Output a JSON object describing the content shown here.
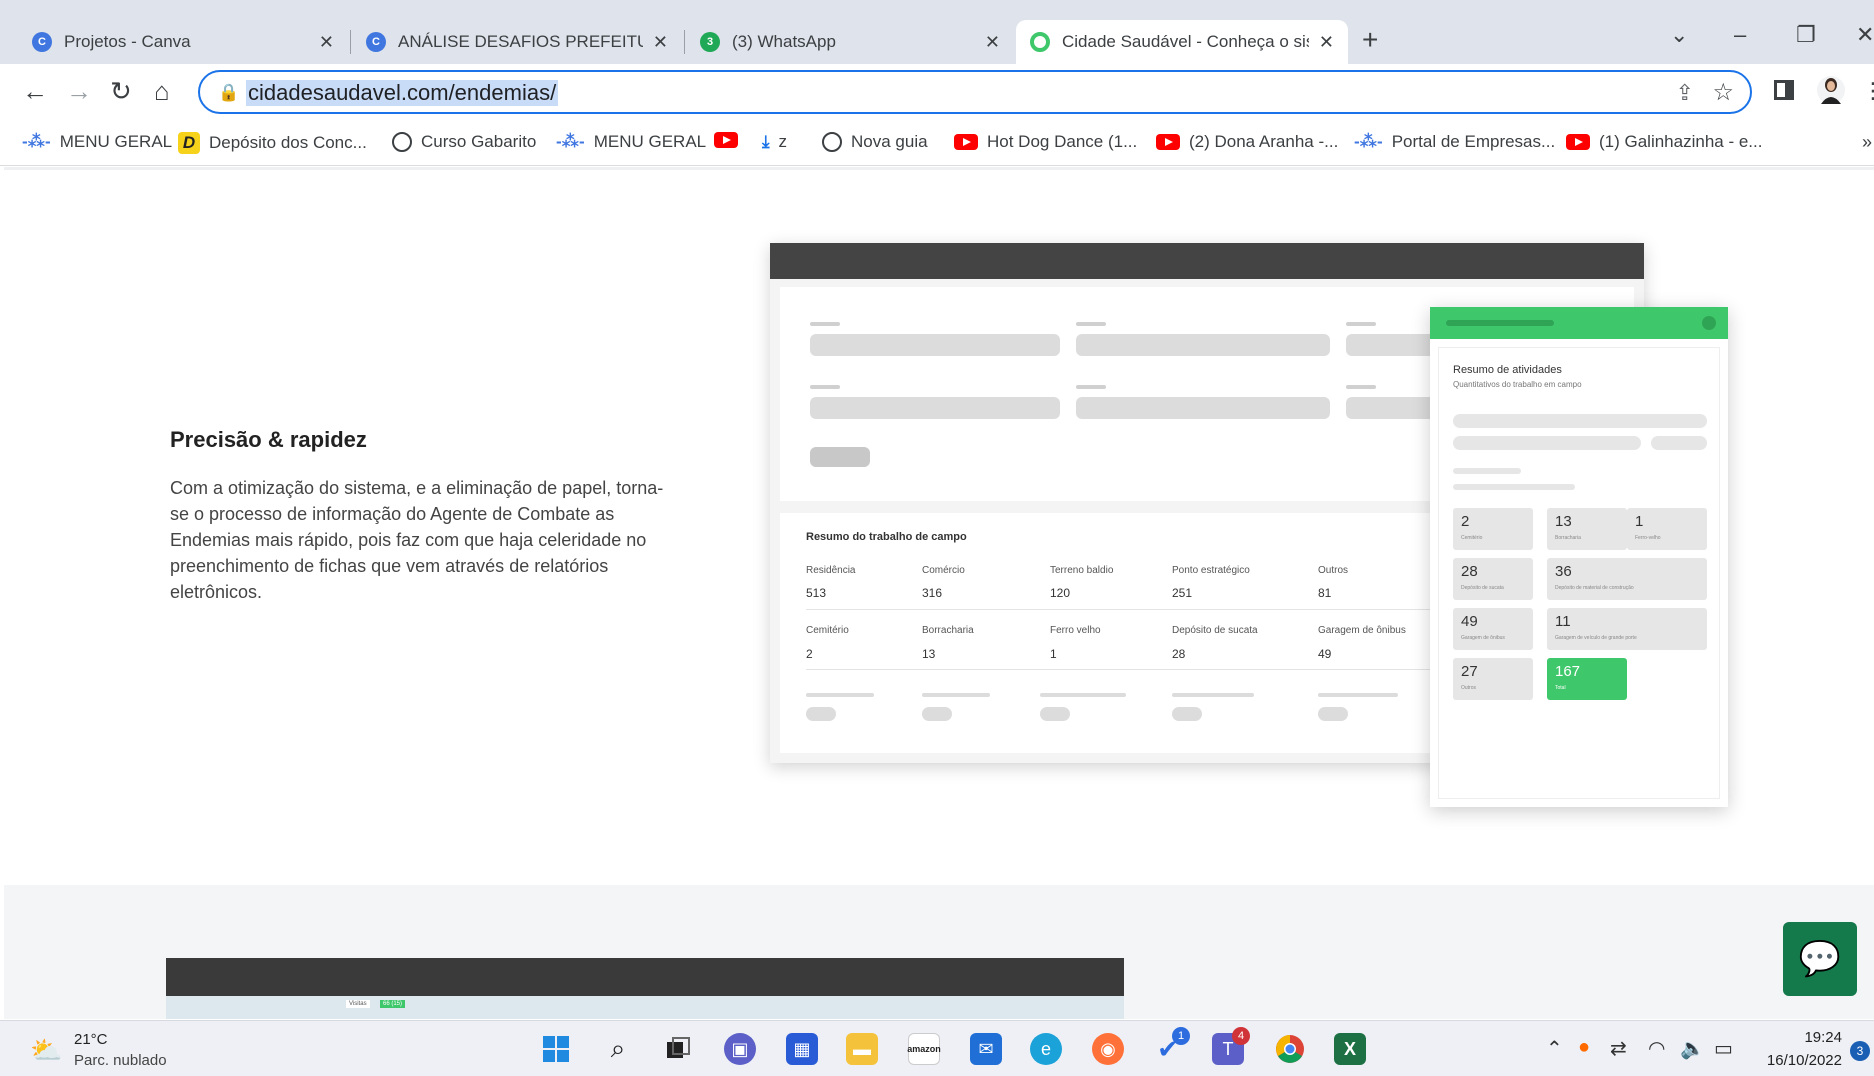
{
  "browser": {
    "tabs": [
      {
        "title": "Projetos - Canva",
        "icon": "canva-icon"
      },
      {
        "title": "ANÁLISE DESAFIOS PREFEITURA",
        "icon": "canva-icon"
      },
      {
        "title": "(3) WhatsApp",
        "icon": "whatsapp-icon",
        "badge": "3"
      },
      {
        "title": "Cidade Saudável - Conheça o sis",
        "icon": "cidade-saudavel-icon",
        "active": true
      }
    ],
    "close_glyph": "✕",
    "new_tab_glyph": "+",
    "url": "cidadesaudavel.com/endemias/"
  },
  "bookmarks": [
    {
      "label": "MENU GERAL",
      "icon": "network-icon"
    },
    {
      "label": "Depósito dos Conc...",
      "icon": "d-logo-icon"
    },
    {
      "label": "Curso Gabarito",
      "icon": "globe-icon"
    },
    {
      "label": "MENU GERAL",
      "icon": "network-icon"
    },
    {
      "label": "",
      "icon": "youtube-icon"
    },
    {
      "label": "z",
      "icon": "download-icon"
    },
    {
      "label": "Nova guia",
      "icon": "globe-icon"
    },
    {
      "label": "Hot Dog Dance (1...",
      "icon": "youtube-icon"
    },
    {
      "label": "(2) Dona Aranha -...",
      "icon": "youtube-icon"
    },
    {
      "label": "Portal de Empresas...",
      "icon": "network-icon"
    },
    {
      "label": "(1) Galinhazinha - e...",
      "icon": "youtube-icon"
    }
  ],
  "feature": {
    "heading": "Precisão & rapidez",
    "paragraph": "Com a otimização do sistema, e a eliminação de papel, torna-se o processo de informação do Agente de Combate as Endemias mais rápido, pois faz com que haja celeridade no preenchimento de fichas que vem através de relatórios eletrônicos."
  },
  "mockup": {
    "summary_title": "Resumo do trabalho de campo",
    "row1": [
      {
        "label": "Residência",
        "value": "513"
      },
      {
        "label": "Comércio",
        "value": "316"
      },
      {
        "label": "Terreno baldio",
        "value": "120"
      },
      {
        "label": "Ponto estratégico",
        "value": "251"
      },
      {
        "label": "Outros",
        "value": "81"
      }
    ],
    "row2": [
      {
        "label": "Cemitério",
        "value": "2"
      },
      {
        "label": "Borracharia",
        "value": "13"
      },
      {
        "label": "Ferro velho",
        "value": "1"
      },
      {
        "label": "Depósito de sucata",
        "value": "28"
      },
      {
        "label": "Garagem de ônibus",
        "value": "49"
      }
    ],
    "panel_title": "Resumo de atividades",
    "panel_subtitle": "Quantitativos do trabalho em campo",
    "tiles": [
      {
        "value": "2",
        "label": "Cemitério"
      },
      {
        "value": "13",
        "label": "Borracharia"
      },
      {
        "value": "1",
        "label": "Ferro-velho"
      },
      {
        "value": "28",
        "label": "Depósito de sucata"
      },
      {
        "value": "36",
        "label": "Depósito de material de construção"
      },
      {
        "value": "49",
        "label": "Garagem de ônibus"
      },
      {
        "value": "11",
        "label": "Garagem de veículo de grande porte"
      },
      {
        "value": "27",
        "label": "Outros"
      },
      {
        "value": "167",
        "label": "Total"
      }
    ],
    "accent_color": "#3fc86b"
  },
  "map_preview": {
    "chip_label": "Visitas",
    "chip_value": "66 (15)"
  },
  "taskbar": {
    "weather_temp": "21°C",
    "weather_desc": "Parc. nublado",
    "time": "19:24",
    "date": "16/10/2022",
    "notification_count": "3",
    "apps": [
      "windows-start-icon",
      "search-icon",
      "task-view-icon",
      "chat-icon",
      "store-icon",
      "file-explorer-icon",
      "amazon-icon",
      "mail-icon",
      "edge-icon",
      "firefox-icon",
      "tasks-icon",
      "teams-icon",
      "chrome-icon",
      "excel-icon"
    ],
    "teams_badge": "4",
    "tasks_badge": "1"
  }
}
